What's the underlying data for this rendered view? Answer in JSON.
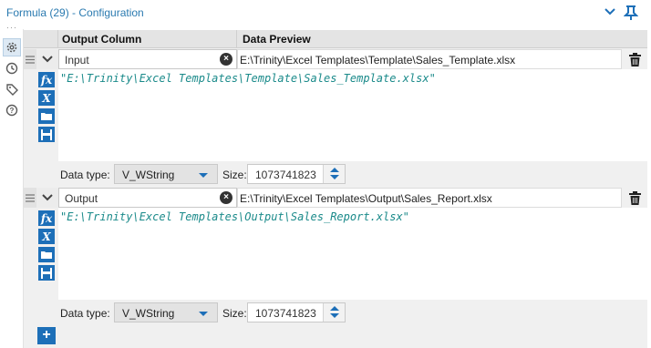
{
  "window": {
    "title": "Formula (29) - Configuration"
  },
  "rail": {
    "icons": [
      "gear-icon",
      "history-icon",
      "tag-icon",
      "help-icon"
    ]
  },
  "grid": {
    "headers": {
      "output_column": "Output Column",
      "data_preview": "Data Preview"
    },
    "rows": [
      {
        "field": "Input",
        "preview": "E:\\Trinity\\Excel Templates\\Template\\Sales_Template.xlsx",
        "expression": "\"E:\\Trinity\\Excel Templates\\Template\\Sales_Template.xlsx\"",
        "data_type_label": "Data type:",
        "data_type": "V_WString",
        "size_label": "Size:",
        "size": "1073741823"
      },
      {
        "field": "Output",
        "preview": "E:\\Trinity\\Excel Templates\\Output\\Sales_Report.xlsx",
        "expression": "\"E:\\Trinity\\Excel Templates\\Output\\Sales_Report.xlsx\"",
        "data_type_label": "Data type:",
        "data_type": "V_WString",
        "size_label": "Size:",
        "size": "1073741823"
      }
    ]
  },
  "colors": {
    "accent": "#1d6fb8",
    "title": "#2a7ab0",
    "expression": "#1a8a8a"
  }
}
